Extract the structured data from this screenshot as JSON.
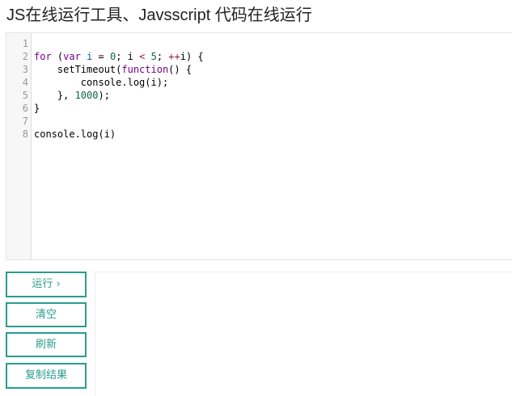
{
  "page": {
    "title": "JS在线运行工具、Javsscript 代码在线运行"
  },
  "editor": {
    "line_numbers": [
      "1",
      "2",
      "3",
      "4",
      "5",
      "6",
      "7",
      "8"
    ],
    "lines": [
      [],
      [
        {
          "t": "for",
          "c": "kw"
        },
        {
          "t": " (",
          "c": ""
        },
        {
          "t": "var",
          "c": "kw"
        },
        {
          "t": " ",
          "c": ""
        },
        {
          "t": "i",
          "c": "var"
        },
        {
          "t": " = ",
          "c": ""
        },
        {
          "t": "0",
          "c": "num"
        },
        {
          "t": "; i ",
          "c": ""
        },
        {
          "t": "<",
          "c": "op"
        },
        {
          "t": " ",
          "c": ""
        },
        {
          "t": "5",
          "c": "num"
        },
        {
          "t": "; ",
          "c": ""
        },
        {
          "t": "++",
          "c": "op"
        },
        {
          "t": "i) {",
          "c": ""
        }
      ],
      [
        {
          "t": "    setTimeout(",
          "c": ""
        },
        {
          "t": "function",
          "c": "kw"
        },
        {
          "t": "() {",
          "c": ""
        }
      ],
      [
        {
          "t": "        console.log(i);",
          "c": ""
        }
      ],
      [
        {
          "t": "    }, ",
          "c": ""
        },
        {
          "t": "1000",
          "c": "num"
        },
        {
          "t": ");",
          "c": ""
        }
      ],
      [
        {
          "t": "}",
          "c": ""
        }
      ],
      [],
      [
        {
          "t": "console.log(i)",
          "c": ""
        }
      ]
    ]
  },
  "controls": {
    "run_label": "运行 ›",
    "clear_label": "清空",
    "refresh_label": "刷新",
    "copy_label": "复制结果"
  },
  "colors": {
    "accent": "#2a9d8f",
    "keyword": "#770088",
    "number": "#116644"
  }
}
